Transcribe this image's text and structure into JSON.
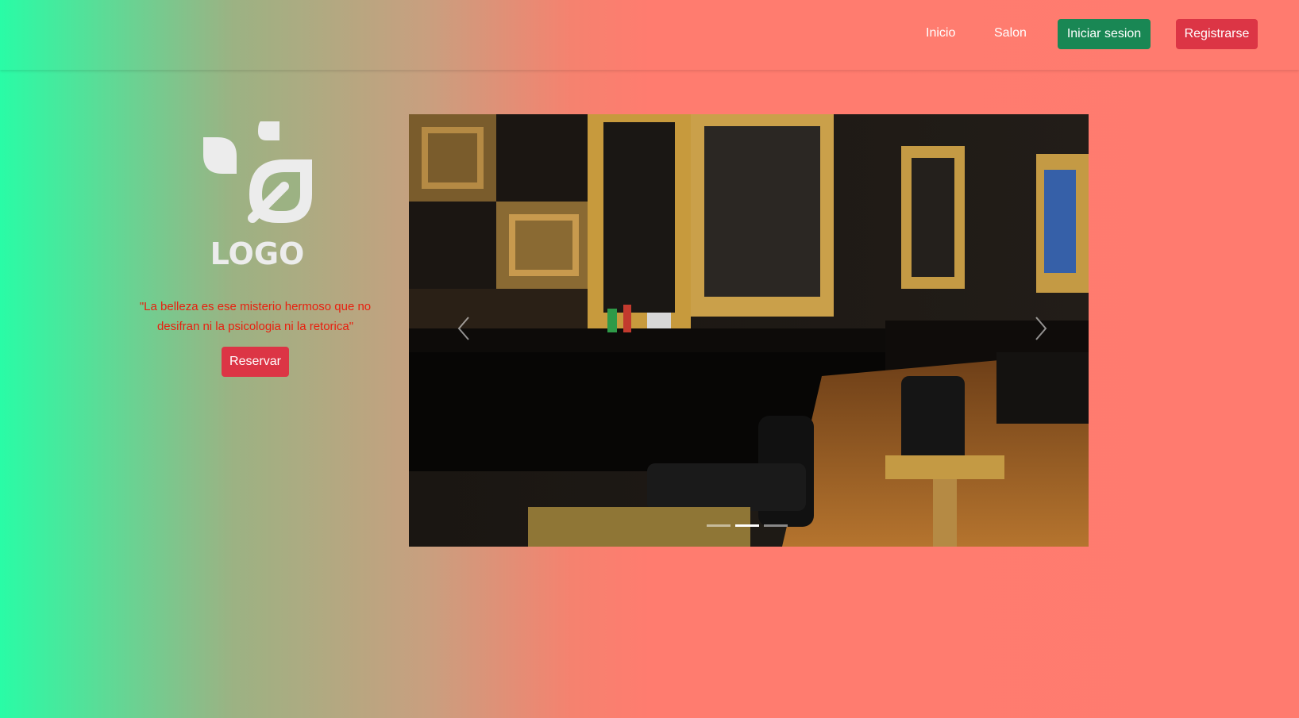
{
  "navbar": {
    "links": [
      "Inicio",
      "Salon"
    ],
    "login_label": "Iniciar sesion",
    "register_label": "Registrarse"
  },
  "hero": {
    "logo_text": "LOGO",
    "quote": "\"La belleza es ese misterio hermoso que no desifran ni la psicologia ni la retorica\"",
    "reserve_label": "Reservar"
  },
  "carousel": {
    "slide_count": 3,
    "active_index": 1,
    "image_subject": "barbershop interior with gold ornate mirrors and barber chairs"
  },
  "colors": {
    "gradient_start": "#29fca6",
    "gradient_end": "#ff7b6f",
    "login_button": "#198754",
    "danger_button": "#dc3545",
    "quote_text": "#e8200f",
    "logo": "#ececec"
  },
  "icons": {
    "prev": "chevron-left-icon",
    "next": "chevron-right-icon",
    "logo": "leaf-logo-icon"
  }
}
